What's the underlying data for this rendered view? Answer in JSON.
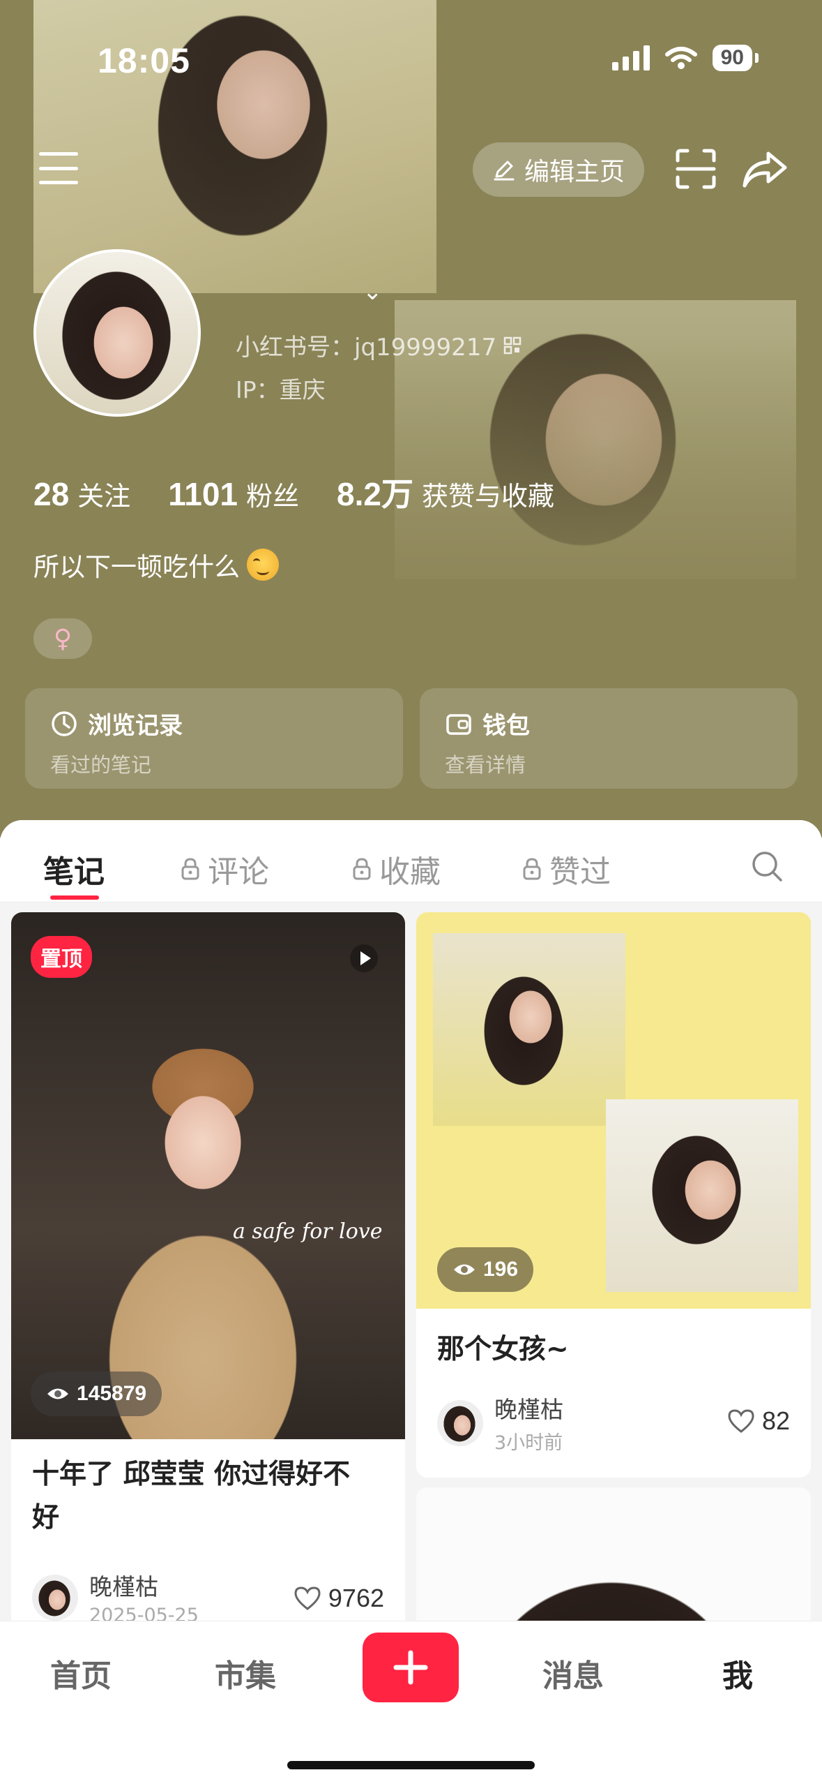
{
  "status_bar": {
    "time": "18:05",
    "battery": "90"
  },
  "header": {
    "edit_label": "编辑主页",
    "red_id": "小红书号：jq19999217",
    "ip": "IP：重庆",
    "stats": [
      {
        "num": "28",
        "label": "关注"
      },
      {
        "num": "1101",
        "label": "粉丝"
      },
      {
        "num": "8.2万",
        "label": "获赞与收藏"
      }
    ],
    "bio": "所以下一顿吃什么",
    "gender": "♀",
    "quick": [
      {
        "title": "浏览记录",
        "sub": "看过的笔记"
      },
      {
        "title": "钱包",
        "sub": "查看详情"
      }
    ]
  },
  "tabs": [
    "笔记",
    "评论",
    "收藏",
    "赞过"
  ],
  "notes": [
    {
      "badge": "置顶",
      "views": "145879",
      "cover_sign": "a safe for love",
      "title_line1": "十年了 邱莹莹 你过得好不",
      "title_line2": "好",
      "author": "晚槿枯",
      "date": "2025-05-25",
      "likes": "9762"
    },
    {
      "views": "196",
      "title": "那个女孩~",
      "author": "晚槿枯",
      "date": "3小时前",
      "likes": "82"
    }
  ],
  "nav": [
    "首页",
    "市集",
    "消息",
    "我"
  ],
  "colors": {
    "accent": "#ff2442",
    "header_bg": "#8a8356",
    "card_yellow": "#f6e98f"
  }
}
